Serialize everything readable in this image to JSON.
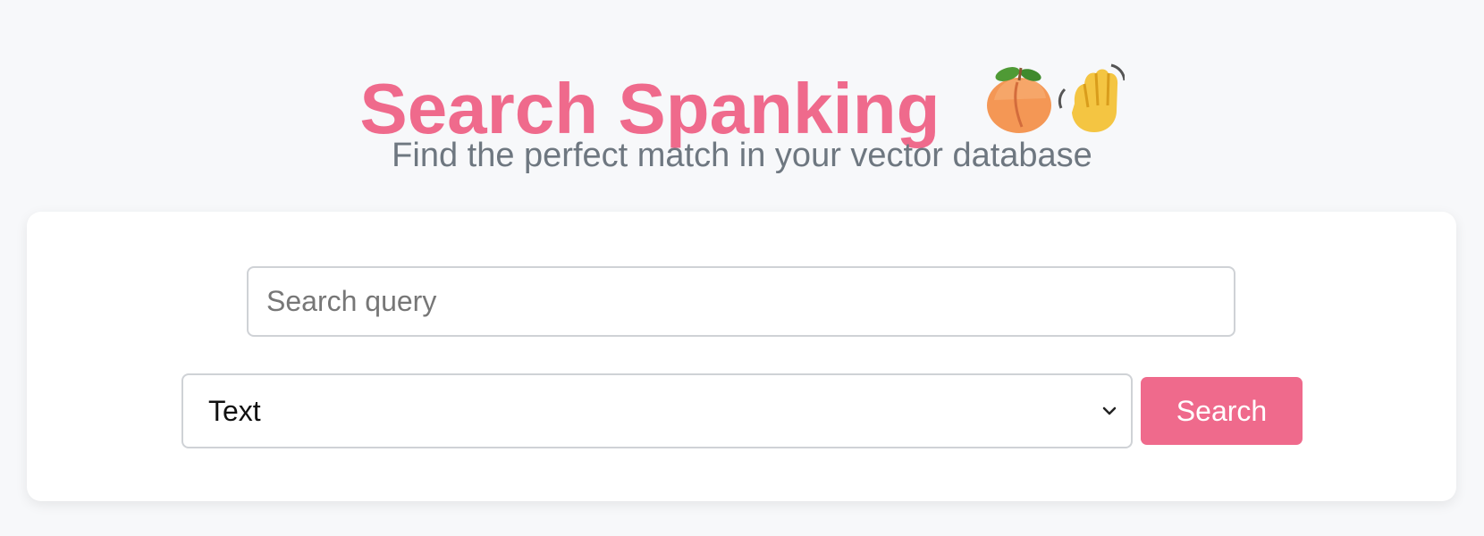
{
  "header": {
    "title": "Search Spanking",
    "emoji_icons": [
      "peach-icon",
      "waving-hand-icon"
    ],
    "subtitle": "Find the perfect match in your vector database"
  },
  "search": {
    "query_placeholder": "Search query",
    "query_value": "",
    "type_selected": "Text",
    "button_label": "Search"
  },
  "colors": {
    "accent": "#ef6a8c",
    "background": "#f7f8fa",
    "card": "#ffffff",
    "subtitle": "#6e7780",
    "border": "#cfd2d6"
  }
}
